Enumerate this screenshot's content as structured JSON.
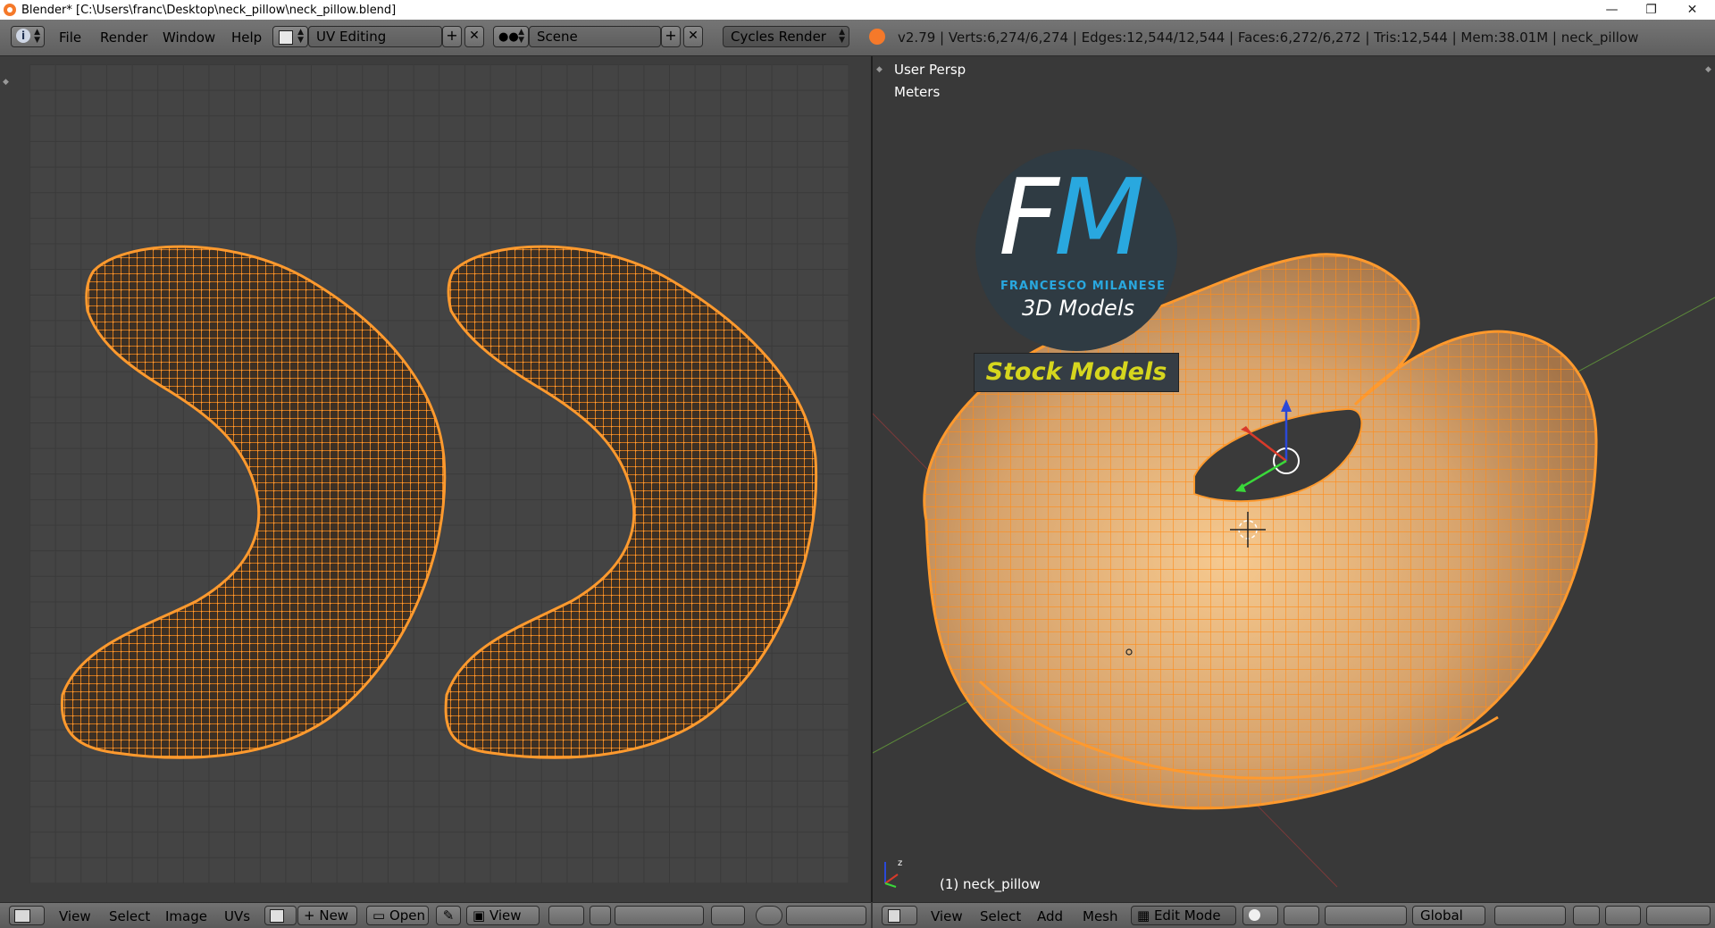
{
  "window": {
    "title": "Blender* [C:\\Users\\franc\\Desktop\\neck_pillow\\neck_pillow.blend]",
    "minimize_icon": "minimize-icon",
    "maximize_icon": "restore-icon",
    "close_icon": "close-icon"
  },
  "topbar": {
    "menus": [
      "File",
      "Render",
      "Window",
      "Help"
    ],
    "screen_layout": "UV Editing",
    "scene": "Scene",
    "render_engine": "Cycles Render",
    "stats": "v2.79 | Verts:6,274/6,274 | Edges:12,544/12,544 | Faces:6,272/6,272 | Tris:12,544 | Mem:38.01M | neck_pillow"
  },
  "viewport": {
    "view_label": "User Persp",
    "units_label": "Meters",
    "object_label": "(1) neck_pillow"
  },
  "watermark": {
    "letters": "FM",
    "name": "FRANCESCO MILANESE",
    "tagline": "3D Models",
    "banner": "Stock Models",
    "colors": {
      "circle": "#2f3b43",
      "f": "#ffffff",
      "m": "#29a8df",
      "banner_text": "#d6d61e"
    }
  },
  "uv_editor_header": {
    "menus": [
      "View",
      "Select",
      "Image",
      "UVs"
    ],
    "new_label": "New",
    "open_label": "Open",
    "view_label": "View"
  },
  "viewport_header": {
    "menus": [
      "View",
      "Select",
      "Add",
      "Mesh"
    ],
    "mode": "Edit Mode",
    "orientation": "Global"
  },
  "colors": {
    "mesh_orange": "#ff8c1a",
    "background": "#393939",
    "header": "#6b6b6b"
  }
}
